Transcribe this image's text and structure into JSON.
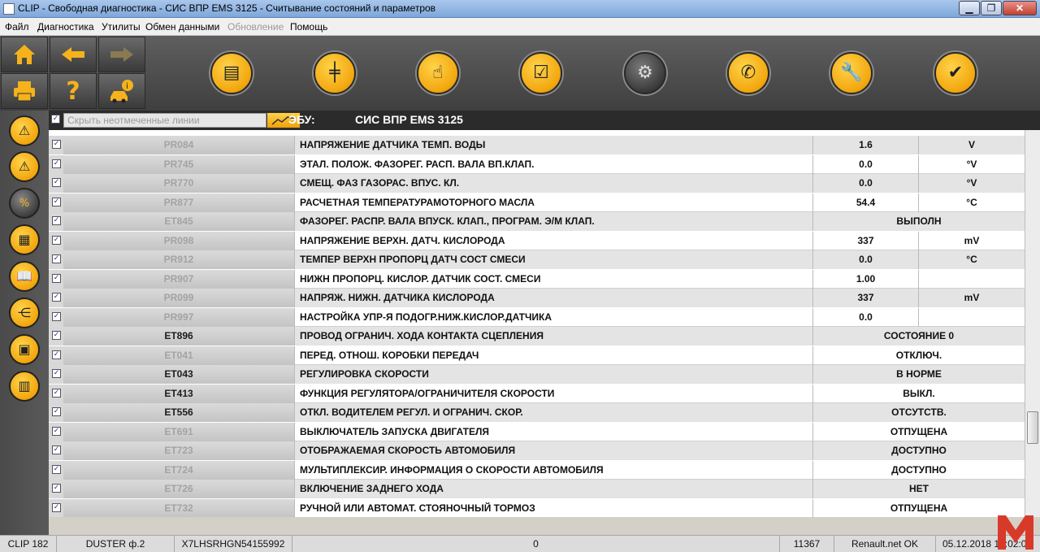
{
  "window": {
    "title": "CLIP - Свободная диагностика - СИС ВПР EMS 3125 - Считывание состояний и параметров"
  },
  "menu": {
    "items": [
      {
        "label": "Файл",
        "disabled": false
      },
      {
        "label": "Диагностика",
        "disabled": false
      },
      {
        "label": "Утилиты",
        "disabled": false
      },
      {
        "label": "Обмен данными",
        "disabled": false
      },
      {
        "label": "Обновление",
        "disabled": true
      },
      {
        "label": "Помощь",
        "disabled": false
      }
    ]
  },
  "toolbar": {
    "left_buttons": [
      {
        "icon": "home-icon"
      },
      {
        "icon": "back-arrow-icon"
      },
      {
        "icon": "forward-arrow-icon"
      },
      {
        "icon": "print-icon"
      },
      {
        "icon": "help-icon"
      },
      {
        "icon": "vehicle-info-icon"
      }
    ],
    "main_buttons": [
      {
        "icon": "vehicle-screen-icon"
      },
      {
        "icon": "gearbox-icon"
      },
      {
        "icon": "touch-icon"
      },
      {
        "icon": "checklist-icon"
      },
      {
        "icon": "car-search-icon",
        "active": true
      },
      {
        "icon": "phone-support-icon"
      },
      {
        "icon": "wrench-icon"
      },
      {
        "icon": "car-check-icon"
      }
    ]
  },
  "sidebar": {
    "buttons": [
      {
        "icon": "fault-warning-icon"
      },
      {
        "icon": "warning-icon"
      },
      {
        "icon": "parameters-percent-icon",
        "active": true
      },
      {
        "icon": "vehicle-config-icon"
      },
      {
        "icon": "manual-book-icon"
      },
      {
        "icon": "wiring-icon"
      },
      {
        "icon": "save-vehicle-icon"
      },
      {
        "icon": "barcode-icon"
      }
    ]
  },
  "header": {
    "hide_unchecked_label": "Скрыть неотмеченные линии",
    "hide_unchecked_checked": true,
    "ecu_label": "ЭБУ:",
    "ecu_name": "СИС ВПР EMS 3125"
  },
  "rows": [
    {
      "code": "PR084",
      "name": "НАПРЯЖЕНИЕ ДАТЧИКА ТЕМП. ВОДЫ",
      "value": "1.6",
      "unit": "V",
      "code_dim": true
    },
    {
      "code": "PR745",
      "name": "ЭТАЛ. ПОЛОЖ. ФАЗОРЕГ. РАСП. ВАЛА ВП.КЛАП.",
      "value": "0.0",
      "unit": "°V",
      "code_dim": true
    },
    {
      "code": "PR770",
      "name": "СМЕЩ. ФАЗ ГАЗОРАС. ВПУС. КЛ.",
      "value": "0.0",
      "unit": "°V",
      "code_dim": true
    },
    {
      "code": "PR877",
      "name": "РАСЧЕТНАЯ ТЕМПЕРАТУРАМОТОРНОГО МАСЛА",
      "value": "54.4",
      "unit": "°C",
      "code_dim": true
    },
    {
      "code": "ET845",
      "name": "ФАЗОРЕГ. РАСПР. ВАЛА ВПУСК. КЛАП., ПРОГРАМ. Э/М КЛАП.",
      "status": "ВЫПОЛН",
      "code_dim": true
    },
    {
      "code": "PR098",
      "name": "НАПРЯЖЕНИЕ ВЕРХН. ДАТЧ. КИСЛОРОДА",
      "value": "337",
      "unit": "mV",
      "code_dim": true
    },
    {
      "code": "PR912",
      "name": "ТЕМПЕР ВЕРХН ПРОПОРЦ ДАТЧ СОСТ СМЕСИ",
      "value": "0.0",
      "unit": "°C",
      "code_dim": true
    },
    {
      "code": "PR907",
      "name": "НИЖН ПРОПОРЦ. КИСЛОР. ДАТЧИК СОСТ. СМЕСИ",
      "value": "1.00",
      "unit": "",
      "code_dim": true
    },
    {
      "code": "PR099",
      "name": "НАПРЯЖ. НИЖН. ДАТЧИКА КИСЛОРОДА",
      "value": "337",
      "unit": "mV",
      "code_dim": true
    },
    {
      "code": "PR997",
      "name": "НАСТРОЙКА УПР-Я ПОДОГР.НИЖ.КИСЛОР.ДАТЧИКА",
      "value": "0.0",
      "unit": "",
      "code_dim": true
    },
    {
      "code": "ET896",
      "name": "ПРОВОД ОГРАНИЧ. ХОДА КОНТАКТА СЦЕПЛЕНИЯ",
      "status": "СОСТОЯНИЕ 0",
      "code_dim": false
    },
    {
      "code": "ET041",
      "name": "ПЕРЕД. ОТНОШ. КОРОБКИ ПЕРЕДАЧ",
      "status": "ОТКЛЮЧ.",
      "code_dim": true
    },
    {
      "code": "ET043",
      "name": "РЕГУЛИРОВКА СКОРОСТИ",
      "status": "В НОРМЕ",
      "code_dim": false
    },
    {
      "code": "ET413",
      "name": "ФУНКЦИЯ РЕГУЛЯТОРА/ОГРАНИЧИТЕЛЯ СКОРОСТИ",
      "status": "ВЫКЛ.",
      "code_dim": false
    },
    {
      "code": "ET556",
      "name": "ОТКЛ. ВОДИТЕЛЕМ РЕГУЛ. И ОГРАНИЧ. СКОР.",
      "status": "ОТСУТСТВ.",
      "code_dim": false
    },
    {
      "code": "ET691",
      "name": "ВЫКЛЮЧАТЕЛЬ ЗАПУСКА ДВИГАТЕЛЯ",
      "status": "ОТПУЩЕНА",
      "code_dim": true
    },
    {
      "code": "ET723",
      "name": "ОТОБРАЖАЕМАЯ СКОРОСТЬ АВТОМОБИЛЯ",
      "status": "ДОСТУПНО",
      "code_dim": true
    },
    {
      "code": "ET724",
      "name": "МУЛЬТИПЛЕКСИР. ИНФОРМАЦИЯ О СКОРОСТИ АВТОМОБИЛЯ",
      "status": "ДОСТУПНО",
      "code_dim": true
    },
    {
      "code": "ET726",
      "name": "ВКЛЮЧЕНИЕ ЗАДНЕГО ХОДА",
      "status": "НЕТ",
      "code_dim": true
    },
    {
      "code": "ET732",
      "name": "РУЧНОЙ ИЛИ АВТОМАТ. СТОЯНОЧНЫЙ ТОРМОЗ",
      "status": "ОТПУЩЕНА",
      "code_dim": true
    }
  ],
  "statusbar": {
    "version": "CLIP 182",
    "vehicle": "DUSTER ф.2",
    "vin": "X7LHSRHGN54155992",
    "counter": "0",
    "code": "11367",
    "connection": "Renault.net OK",
    "date": "05.12.2018",
    "time": "10:02:0"
  },
  "colors": {
    "accent_yellow": "#f2a60d",
    "toolbar_dark": "#4a4a4a",
    "row_alt": "#e4e4e4",
    "code_dim_text": "#a3a3a3"
  }
}
